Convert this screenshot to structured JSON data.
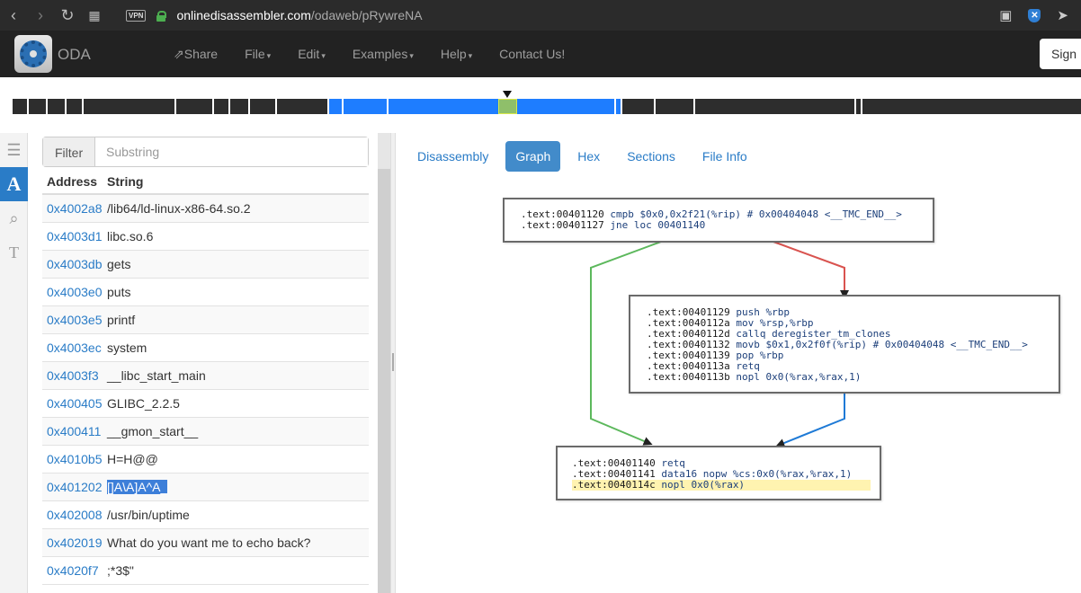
{
  "browser": {
    "url_host": "onlinedisassembler.com",
    "url_path": "/odaweb/pRywreNA",
    "vpn_label": "VPN"
  },
  "navbar": {
    "brand": "ODA",
    "menu": [
      {
        "label": "Share",
        "caret": false
      },
      {
        "label": "File",
        "caret": true
      },
      {
        "label": "Edit",
        "caret": true
      },
      {
        "label": "Examples",
        "caret": true
      },
      {
        "label": "Help",
        "caret": true
      },
      {
        "label": "Contact Us!",
        "caret": false
      }
    ],
    "sign_label": "Sign"
  },
  "strings_panel": {
    "filter_label": "Filter",
    "filter_placeholder": "Substring",
    "columns": [
      "Address",
      "String"
    ],
    "rows": [
      {
        "address": "0x4002a8",
        "string": "/lib64/ld-linux-x86-64.so.2"
      },
      {
        "address": "0x4003d1",
        "string": "libc.so.6"
      },
      {
        "address": "0x4003db",
        "string": "gets"
      },
      {
        "address": "0x4003e0",
        "string": "puts"
      },
      {
        "address": "0x4003e5",
        "string": "printf"
      },
      {
        "address": "0x4003ec",
        "string": "system"
      },
      {
        "address": "0x4003f3",
        "string": "__libc_start_main"
      },
      {
        "address": "0x400405",
        "string": "GLIBC_2.2.5"
      },
      {
        "address": "0x400411",
        "string": "__gmon_start__"
      },
      {
        "address": "0x4010b5",
        "string": "H=H@@"
      },
      {
        "address": "0x401202",
        "string": "[]A\\A]A^A_",
        "selected": true
      },
      {
        "address": "0x402008",
        "string": "/usr/bin/uptime"
      },
      {
        "address": "0x402019",
        "string": "What do you want me to echo back?"
      },
      {
        "address": "0x4020f7",
        "string": ";*3$\""
      }
    ]
  },
  "view_tabs": {
    "items": [
      "Disassembly",
      "Graph",
      "Hex",
      "Sections",
      "File Info"
    ],
    "active": "Graph"
  },
  "graph": {
    "nodes": [
      {
        "id": "block-401120",
        "lines": [
          {
            "addr": ".text:00401120",
            "code": "cmpb $0x0,0x2f21(%rip) # 0x00404048 <__TMC_END__>"
          },
          {
            "addr": ".text:00401127",
            "code": "jne loc 00401140"
          }
        ]
      },
      {
        "id": "block-401129",
        "lines": [
          {
            "addr": ".text:00401129",
            "code": "push %rbp"
          },
          {
            "addr": ".text:0040112a",
            "code": "mov %rsp,%rbp"
          },
          {
            "addr": ".text:0040112d",
            "code": "callq deregister_tm_clones"
          },
          {
            "addr": ".text:00401132",
            "code": "movb $0x1,0x2f0f(%rip) # 0x00404048 <__TMC_END__>"
          },
          {
            "addr": ".text:00401139",
            "code": "pop %rbp"
          },
          {
            "addr": ".text:0040113a",
            "code": "retq"
          },
          {
            "addr": ".text:0040113b",
            "code": "nopl 0x0(%rax,%rax,1)"
          }
        ]
      },
      {
        "id": "block-401140",
        "lines": [
          {
            "addr": ".text:00401140",
            "code": "retq"
          },
          {
            "addr": ".text:00401141",
            "code": "data16 nopw %cs:0x0(%rax,%rax,1)"
          },
          {
            "addr": ".text:0040114c",
            "code": "nopl 0x0(%rax)",
            "highlight": true
          }
        ]
      }
    ],
    "edge_colors": {
      "true_branch": "#5cb85c",
      "false_branch": "#d9534f",
      "unconditional": "#1e7ad6"
    }
  },
  "colors": {
    "accent": "#428bca",
    "overview_code": "#1e7dff",
    "overview_data": "#2d2d2d",
    "overview_cursor": "#8fbf6a"
  }
}
